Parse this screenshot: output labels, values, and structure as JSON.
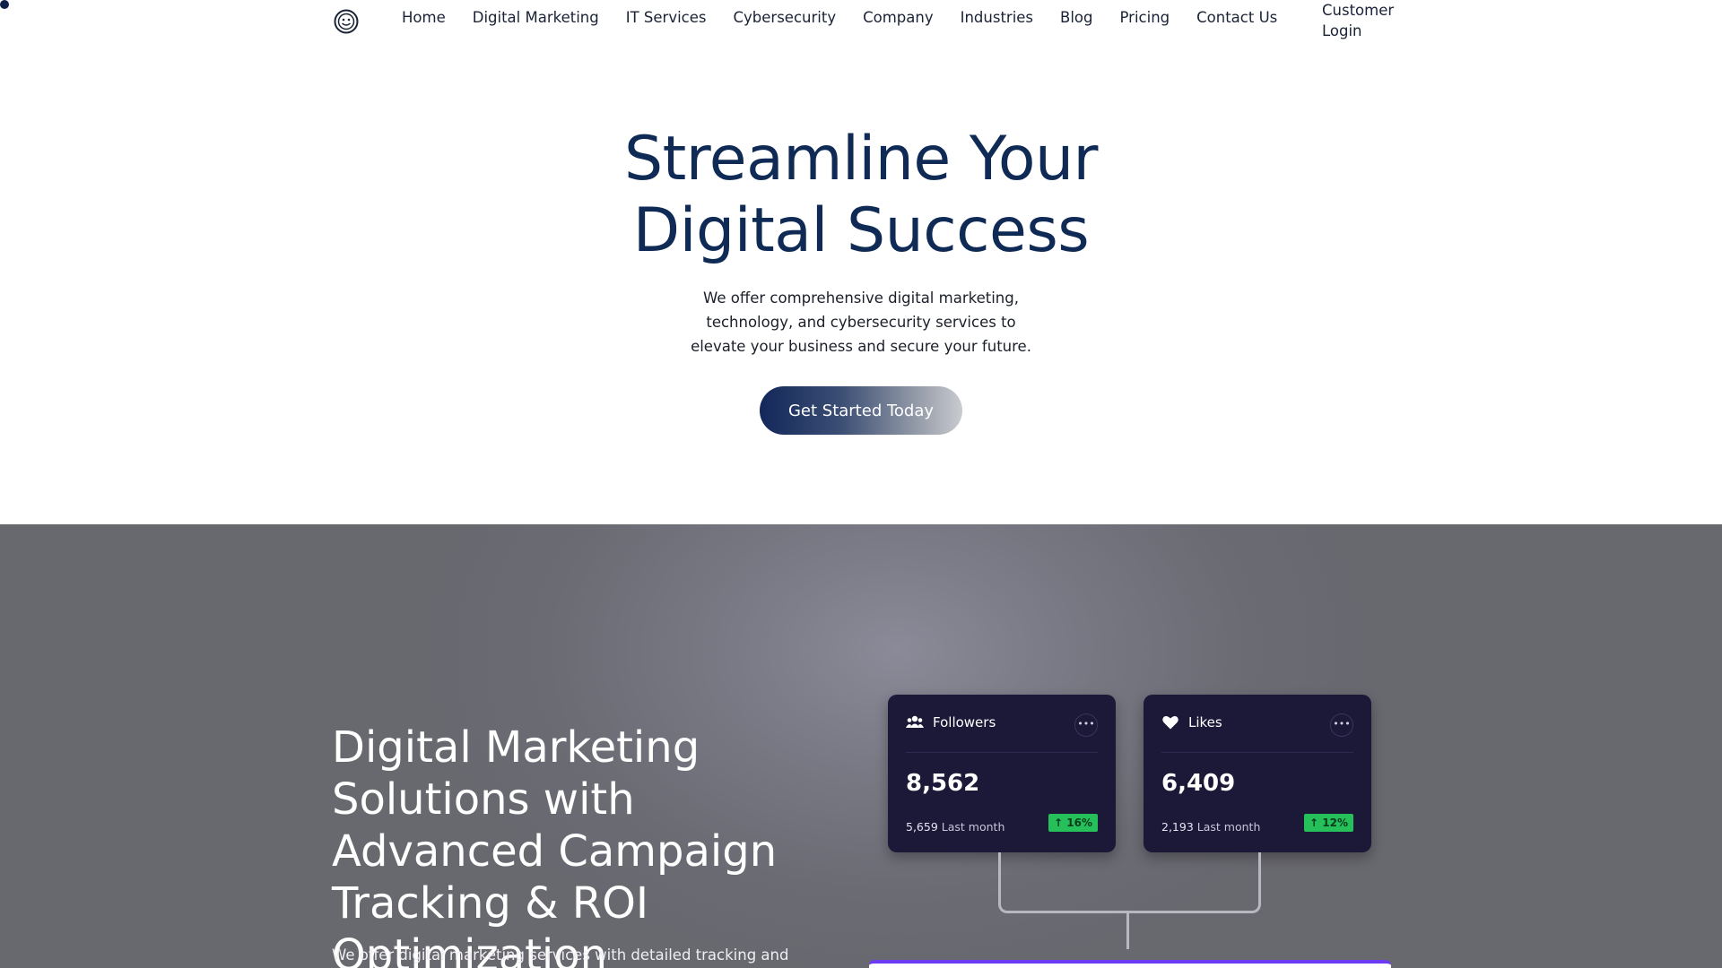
{
  "nav": {
    "links": [
      "Home",
      "Digital Marketing",
      "IT Services",
      "Cybersecurity",
      "Company",
      "Industries",
      "Blog",
      "Pricing",
      "Contact Us"
    ],
    "login": "Customer Login"
  },
  "hero": {
    "title_line1": "Streamline Your",
    "title_line2": "Digital Success",
    "subtitle": "We offer comprehensive digital marketing, technology, and cybersecurity services to elevate your business and secure your future.",
    "cta": "Get Started Today"
  },
  "section2": {
    "title": "Digital Marketing Solutions with Advanced Campaign Tracking & ROI Optimization",
    "subtitle": "We offer digital marketing services with detailed tracking and"
  },
  "cards": [
    {
      "label": "Followers",
      "value": "8,562",
      "last_value": "5,659",
      "last_label": "Last month",
      "change": "↑ 16%",
      "icon": "users-icon"
    },
    {
      "label": "Likes",
      "value": "6,409",
      "last_value": "2,193",
      "last_label": "Last month",
      "change": "↑ 12%",
      "icon": "heart-icon"
    }
  ],
  "colors": {
    "brand_navy": "#0f2a55",
    "card_bg": "#1c1838",
    "badge_green": "#25c05a",
    "accent_purple": "#6c3af2"
  }
}
